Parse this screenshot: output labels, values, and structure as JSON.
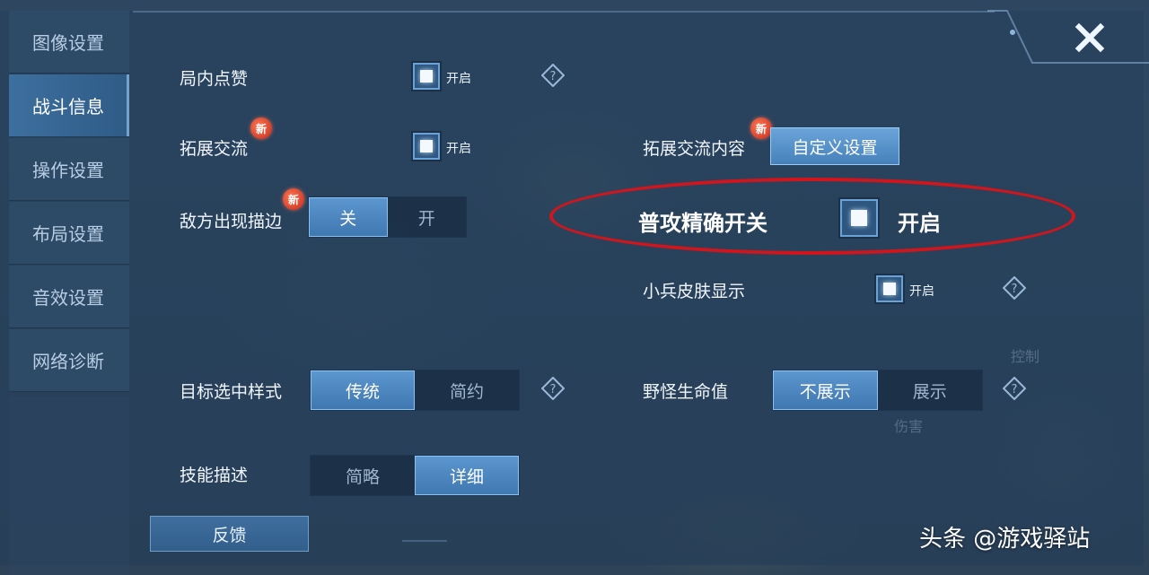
{
  "sidebar": {
    "items": [
      {
        "label": "图像设置"
      },
      {
        "label": "战斗信息"
      },
      {
        "label": "操作设置"
      },
      {
        "label": "布局设置"
      },
      {
        "label": "音效设置"
      },
      {
        "label": "网络诊断"
      }
    ],
    "active_index": 1
  },
  "settings": {
    "like_in_game": {
      "label": "局内点赞",
      "checkbox_label": "开启"
    },
    "expand_chat": {
      "label": "拓展交流",
      "checkbox_label": "开启",
      "badge": "新"
    },
    "expand_chat_content": {
      "label": "拓展交流内容",
      "badge": "新",
      "button": "自定义设置"
    },
    "enemy_outline": {
      "label": "敌方出现描边",
      "badge": "新",
      "options": [
        "关",
        "开"
      ],
      "selected": "关"
    },
    "precise_attack": {
      "label": "普攻精确开关",
      "checkbox_label": "开启"
    },
    "minion_skin": {
      "label": "小兵皮肤显示",
      "checkbox_label": "开启"
    },
    "target_style": {
      "label": "目标选中样式",
      "options": [
        "传统",
        "简约"
      ],
      "selected": "传统"
    },
    "monster_hp": {
      "label": "野怪生命值",
      "options": [
        "不展示",
        "展示"
      ],
      "selected": "不展示"
    },
    "skill_desc": {
      "label": "技能描述",
      "options": [
        "简略",
        "详细"
      ],
      "selected": "详细"
    }
  },
  "feedback_label": "反馈",
  "background_text": {
    "control": "控制",
    "damage": "伤害"
  },
  "watermark": "头条 @游戏驿站",
  "colors": {
    "accent": "#4a86c0",
    "highlight_ellipse": "#d0161c",
    "new_badge": "#d8321f"
  },
  "icons": {
    "close": "close-icon",
    "help": "help-diamond-icon"
  }
}
